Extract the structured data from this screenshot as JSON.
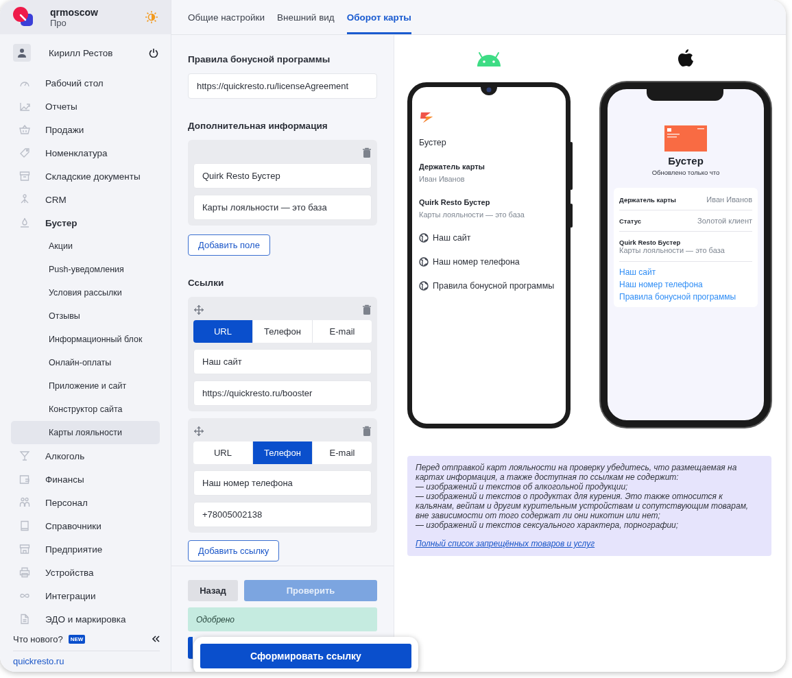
{
  "sidebar": {
    "org": {
      "name": "qrmoscow",
      "plan": "Про"
    },
    "user": {
      "name": "Кирилл Рестов"
    },
    "items": [
      {
        "label": "Рабочий стол",
        "selected": false,
        "expanded": false
      },
      {
        "label": "Отчеты",
        "selected": false,
        "expanded": false
      },
      {
        "label": "Продажи",
        "selected": false,
        "expanded": false
      },
      {
        "label": "Номенклатура",
        "selected": false,
        "expanded": false
      },
      {
        "label": "Складские документы",
        "selected": false,
        "expanded": false
      },
      {
        "label": "CRM",
        "selected": false,
        "expanded": false
      },
      {
        "label": "Бустер",
        "selected": false,
        "expanded": true,
        "children": [
          {
            "label": "Акции",
            "selected": false
          },
          {
            "label": "Push-уведомления",
            "selected": false
          },
          {
            "label": "Условия рассылки",
            "selected": false
          },
          {
            "label": "Отзывы",
            "selected": false
          },
          {
            "label": "Информационный блок",
            "selected": false
          },
          {
            "label": "Онлайн-оплаты",
            "selected": false
          },
          {
            "label": "Приложение и сайт",
            "selected": false
          },
          {
            "label": "Конструктор сайта",
            "selected": false
          },
          {
            "label": "Карты лояльности",
            "selected": true
          }
        ]
      },
      {
        "label": "Алкоголь",
        "selected": false,
        "expanded": false
      },
      {
        "label": "Финансы",
        "selected": false,
        "expanded": false
      },
      {
        "label": "Персонал",
        "selected": false,
        "expanded": false
      },
      {
        "label": "Справочники",
        "selected": false,
        "expanded": false
      },
      {
        "label": "Предприятие",
        "selected": false,
        "expanded": false
      },
      {
        "label": "Устройства",
        "selected": false,
        "expanded": false
      },
      {
        "label": "Интеграции",
        "selected": false,
        "expanded": false
      },
      {
        "label": "ЭДО и маркировка",
        "selected": false,
        "expanded": false
      }
    ],
    "whats_new": {
      "label": "Что нового?",
      "badge": "NEW"
    },
    "site_link": "quickresto.ru"
  },
  "tabs": [
    {
      "label": "Общие настройки",
      "selected": false
    },
    {
      "label": "Внешний вид",
      "selected": false
    },
    {
      "label": "Оборот карты",
      "selected": true
    }
  ],
  "form": {
    "rules": {
      "title": "Правила бонусной программы",
      "value": "https://quickresto.ru/licenseAgreement"
    },
    "extra": {
      "title": "Дополнительная информация",
      "fields": [
        "Quirk Resto Бустер",
        "Карты лояльности — это база"
      ],
      "add_button": "Добавить поле"
    },
    "links": {
      "title": "Ссылки",
      "groups": [
        {
          "options": [
            {
              "label": "URL",
              "selected": true
            },
            {
              "label": "Телефон",
              "selected": false
            },
            {
              "label": "E-mail",
              "selected": false
            }
          ],
          "fields": [
            "Наш сайт",
            "https://quickresto.ru/booster"
          ]
        },
        {
          "options": [
            {
              "label": "URL",
              "selected": false
            },
            {
              "label": "Телефон",
              "selected": true
            },
            {
              "label": "E-mail",
              "selected": false
            }
          ],
          "fields": [
            "Наш номер телефона",
            "+78005002138"
          ]
        }
      ],
      "add_button": "Добавить ссылку"
    }
  },
  "footer": {
    "back": "Назад",
    "check": {
      "label": "Проверить",
      "disabled": true
    },
    "status": "Одобрено",
    "generate": "Сформировать ссылку"
  },
  "preview": {
    "android": {
      "title": "Бустер",
      "fields": [
        {
          "label": "Держатель карты",
          "value": "Иван Иванов"
        },
        {
          "label": "Quirk Resto Бустер",
          "value": "Карты лояльности — это база"
        }
      ],
      "links": [
        "Наш сайт",
        "Наш номер телефона",
        "Правила бонусной программы"
      ]
    },
    "ios": {
      "title": "Бустер",
      "subtitle": "Обновлено только что",
      "rows": [
        {
          "kind": "inline",
          "label": "Держатель карты",
          "value": "Иван Иванов"
        },
        {
          "kind": "inline",
          "label": "Статус",
          "value": "Золотой клиент"
        },
        {
          "kind": "stacked",
          "label": "Quirk Resto Бустер",
          "value": "Карты лояльности — это база"
        }
      ],
      "links": [
        "Наш сайт",
        "Наш номер телефона",
        "Правила бонусной программы"
      ]
    },
    "notice": {
      "text": "Перед отправкой карт лояльности на проверку убедитесь, что размещаемая на картах информация, а также доступная по ссылкам не содержит:\n— изображений и текстов об алкогольной продукции;\n— изображений и текстов о продуктах для курения. Это также относится к кальянам, вейпам и другим курительным устройствам и сопутствующим товарам, вне зависимости от того содержат ли они никотин или нет;\n— изображений и текстов сексуального характера, порнографии;",
      "link": "Полный список запрещённых товаров и услуг"
    }
  }
}
